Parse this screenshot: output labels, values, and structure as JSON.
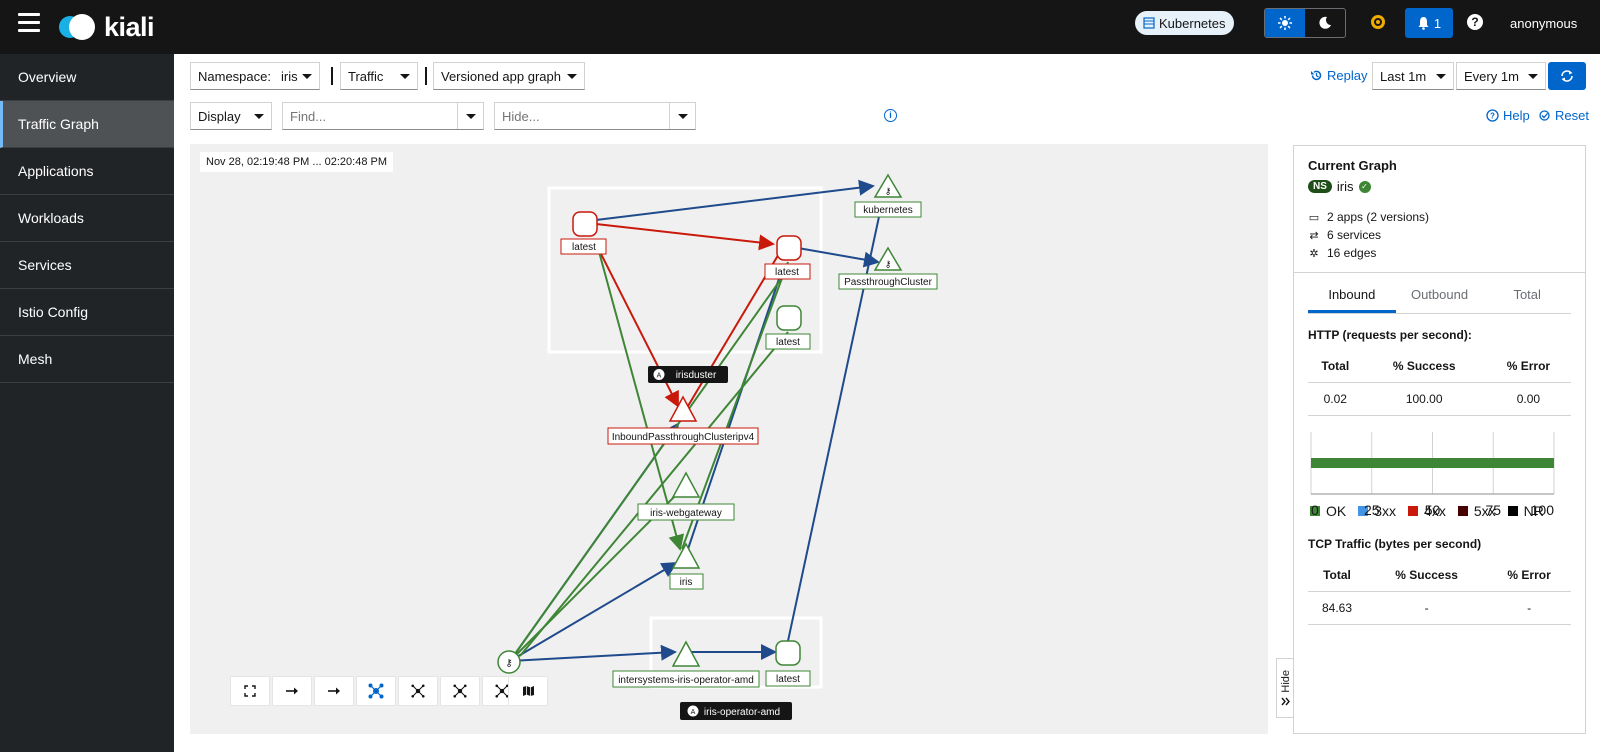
{
  "header": {
    "brand": "kiali",
    "cluster_chip": "Kubernetes",
    "notification_count": "1",
    "user": "anonymous"
  },
  "sidebar": {
    "items": [
      {
        "label": "Overview",
        "active": false
      },
      {
        "label": "Traffic Graph",
        "active": true
      },
      {
        "label": "Applications",
        "active": false
      },
      {
        "label": "Workloads",
        "active": false
      },
      {
        "label": "Services",
        "active": false
      },
      {
        "label": "Istio Config",
        "active": false
      },
      {
        "label": "Mesh",
        "active": false
      }
    ]
  },
  "toolbar": {
    "namespace_label": "Namespace:",
    "namespace_value": "iris",
    "traffic": "Traffic",
    "graph_type": "Versioned app graph",
    "replay": "Replay",
    "duration": "Last 1m",
    "refresh_interval": "Every 1m",
    "display": "Display",
    "find_placeholder": "Find...",
    "hide_placeholder": "Hide...",
    "help": "Help",
    "reset": "Reset"
  },
  "graph": {
    "timestamp": "Nov 28, 02:19:48 PM ... 02:20:48 PM",
    "boxes": {
      "iriscluster": "irisduster",
      "iris_operator": "iris-operator-amd"
    },
    "nodes": {
      "n1": "latest",
      "n2": "latest",
      "n3": "latest",
      "n4": "latest",
      "kubernetes": "kubernetes",
      "passthrough": "PassthroughCluster",
      "inbound": "InboundPassthroughClusteripv4",
      "webgateway": "iris-webgateway",
      "iris": "iris",
      "operator": "intersystems-iris-operator-amd"
    },
    "colors": {
      "healthy": "#3e8635",
      "error": "#c9190b",
      "tcp": "#1f4a8c"
    },
    "hide_tab": "Hide"
  },
  "panel": {
    "title": "Current Graph",
    "ns_badge": "NS",
    "namespace": "iris",
    "apps": "2 apps (2 versions)",
    "services": "6 services",
    "edges": "16 edges",
    "tabs": [
      "Inbound",
      "Outbound",
      "Total"
    ],
    "http_title": "HTTP (requests per second):",
    "http_headers": [
      "Total",
      "% Success",
      "% Error"
    ],
    "http_values": [
      "0.02",
      "100.00",
      "0.00"
    ],
    "chart_ticks": [
      "0",
      "25",
      "50",
      "75",
      "100"
    ],
    "ok_percent": 100,
    "legend": [
      {
        "label": "OK",
        "color": "#3e8635"
      },
      {
        "label": "3xx",
        "color": "#4394e5"
      },
      {
        "label": "4xx",
        "color": "#c9190b"
      },
      {
        "label": "5xx",
        "color": "#470000"
      },
      {
        "label": "NR",
        "color": "#000000"
      }
    ],
    "tcp_title": "TCP Traffic (bytes per second)",
    "tcp_headers": [
      "Total",
      "% Success",
      "% Error"
    ],
    "tcp_values": [
      "84.63",
      "-",
      "-"
    ]
  }
}
